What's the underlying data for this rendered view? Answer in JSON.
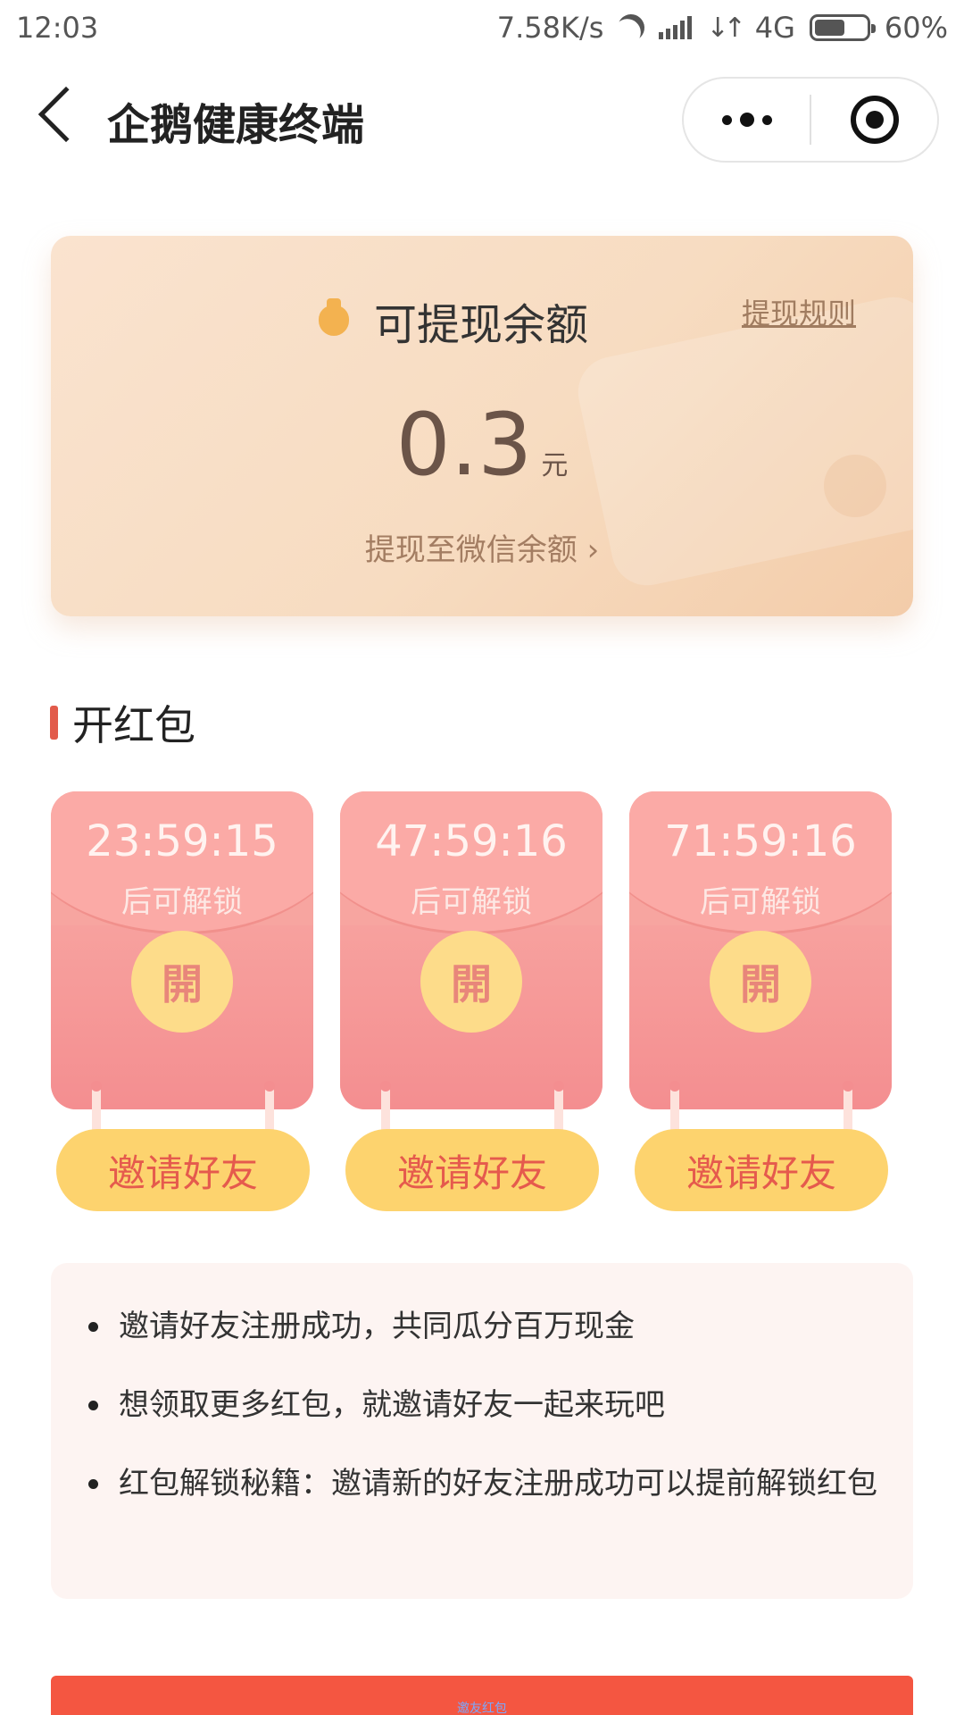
{
  "status_bar": {
    "time": "12:03",
    "net_speed": "7.58K/s",
    "network": "4G",
    "battery_percent": "60%",
    "battery_level": 0.6,
    "icons": [
      "moon-icon",
      "signal-icon",
      "data-arrows-icon",
      "battery-icon"
    ]
  },
  "header": {
    "title": "企鹅健康终端",
    "back_icon": "back-chevron-icon",
    "menu_icon": "more-dots-icon",
    "close_icon": "target-circle-icon"
  },
  "balance": {
    "label": "可提现余额",
    "rules_link": "提现规则",
    "amount": "0.3",
    "unit": "元",
    "withdraw_link": "提现至微信余额 ›",
    "icon": "money-bag-icon"
  },
  "section": {
    "title": "开红包"
  },
  "packets": [
    {
      "timer": "23:59:15",
      "unlock_text": "后可解锁",
      "open_label": "開",
      "invite_label": "邀请好友"
    },
    {
      "timer": "47:59:16",
      "unlock_text": "后可解锁",
      "open_label": "開",
      "invite_label": "邀请好友"
    },
    {
      "timer": "71:59:16",
      "unlock_text": "后可解锁",
      "open_label": "開",
      "invite_label": "邀请好友"
    }
  ],
  "tips": [
    "邀请好友注册成功，共同瓜分百万现金",
    "想领取更多红包，就邀请好友一起来玩吧",
    "红包解锁秘籍：邀请新的好友注册成功可以提前解锁红包"
  ],
  "bottom": {
    "label": "邀友红包"
  },
  "colors": {
    "accent_red": "#e25b4b",
    "packet_pink": "#f7a5a0",
    "gold": "#fdd36e",
    "card_peach": "#f7dcc1"
  }
}
